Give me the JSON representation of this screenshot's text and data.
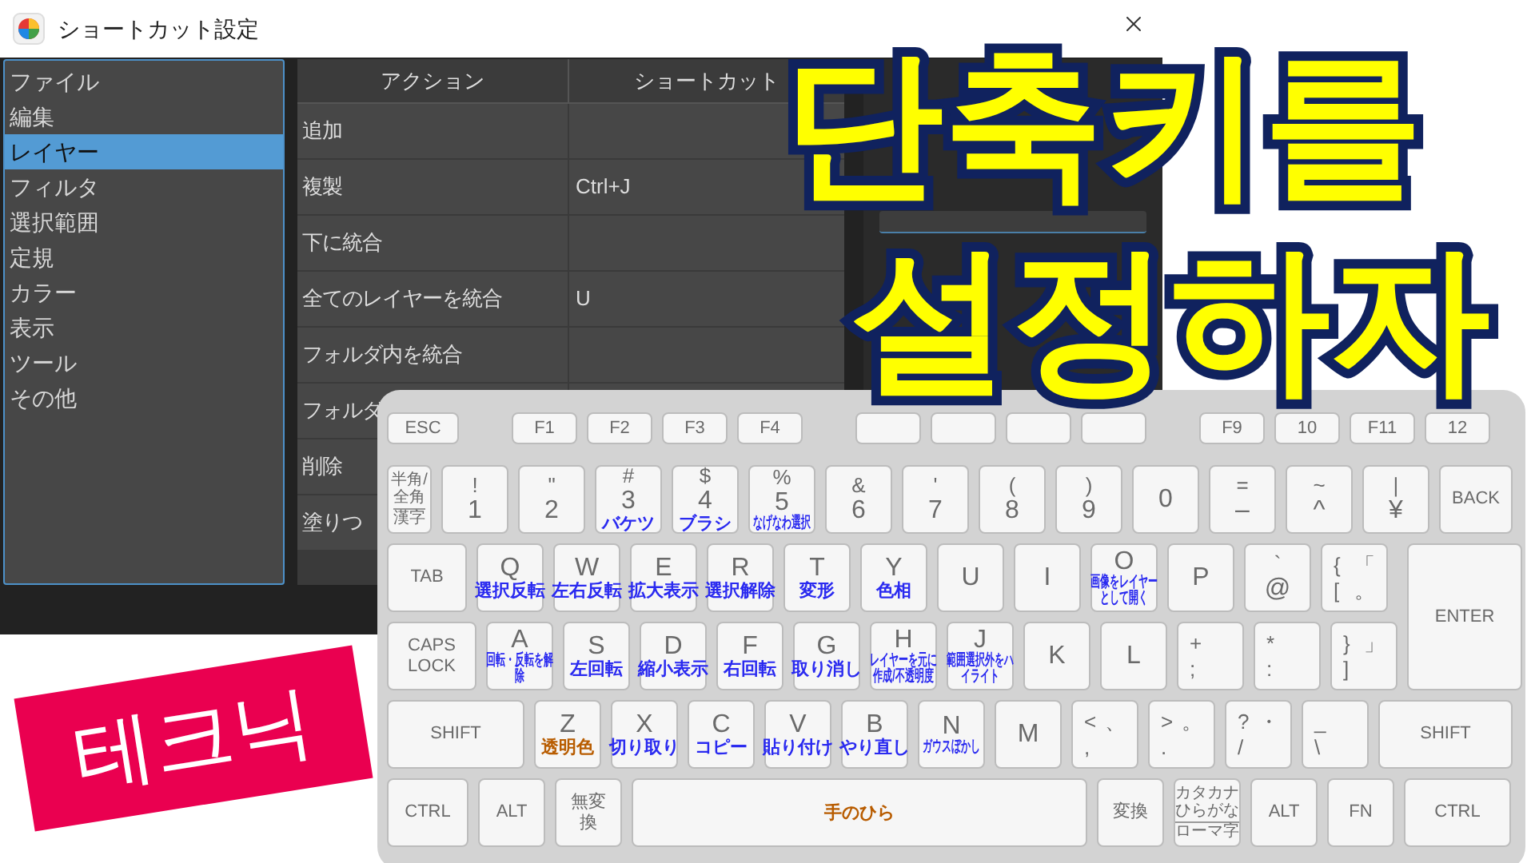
{
  "dialog": {
    "title": "ショートカット設定",
    "categories": [
      {
        "label": "ファイル",
        "selected": false
      },
      {
        "label": "編集",
        "selected": false
      },
      {
        "label": "レイヤー",
        "selected": true
      },
      {
        "label": "フィルタ",
        "selected": false
      },
      {
        "label": "選択範囲",
        "selected": false
      },
      {
        "label": "定規",
        "selected": false
      },
      {
        "label": "カラー",
        "selected": false
      },
      {
        "label": "表示",
        "selected": false
      },
      {
        "label": "ツール",
        "selected": false
      },
      {
        "label": "その他",
        "selected": false
      }
    ],
    "table": {
      "columns": [
        "アクション",
        "ショートカット"
      ],
      "rows": [
        {
          "action": "追加"
        },
        {
          "action": "複製",
          "shortcut": "Ctrl+J"
        },
        {
          "action": "下に統合"
        },
        {
          "action": "全てのレイヤーを統合",
          "shortcut": "U"
        },
        {
          "action": "フォルダ内を統合"
        },
        {
          "action": "フォルダ"
        },
        {
          "action": "削除"
        },
        {
          "action": "塗りつ"
        }
      ]
    }
  },
  "keyboard": {
    "rows": [
      {
        "keys": [
          {
            "kind": "label",
            "label": "ESC"
          },
          {
            "kind": "label",
            "label": "F1"
          },
          {
            "kind": "label",
            "label": "F2"
          },
          {
            "kind": "label",
            "label": "F3"
          },
          {
            "kind": "label",
            "label": "F4"
          },
          {
            "kind": "blank"
          },
          {
            "kind": "blank"
          },
          {
            "kind": "blank"
          },
          {
            "kind": "blank"
          },
          {
            "kind": "label",
            "label": "F9"
          },
          {
            "kind": "label",
            "label": "10"
          },
          {
            "kind": "label",
            "label": "F11"
          },
          {
            "kind": "label",
            "label": "12"
          }
        ]
      },
      {
        "keys": [
          {
            "kind": "stack",
            "lines": [
              "半角/",
              "全角",
              "漢字"
            ]
          },
          {
            "kind": "sym",
            "top": "!",
            "main": "1"
          },
          {
            "kind": "sym",
            "top": "\"",
            "main": "2"
          },
          {
            "kind": "sym",
            "top": "#",
            "main": "3",
            "action": "バケツ",
            "color": "#2a2af0"
          },
          {
            "kind": "sym",
            "top": "$",
            "main": "4",
            "action": "ブラシ",
            "color": "#2a2af0"
          },
          {
            "kind": "sym",
            "top": "%",
            "main": "5",
            "action": "なげなわ選択",
            "color": "#2a2af0"
          },
          {
            "kind": "sym",
            "top": "&",
            "main": "6"
          },
          {
            "kind": "sym",
            "top": "'",
            "main": "7"
          },
          {
            "kind": "sym",
            "top": "(",
            "main": "8"
          },
          {
            "kind": "sym",
            "top": ")",
            "main": "9"
          },
          {
            "kind": "sym",
            "main": "0"
          },
          {
            "kind": "sym",
            "top": "=",
            "main": "–"
          },
          {
            "kind": "sym",
            "top": "~",
            "main": "^"
          },
          {
            "kind": "sym",
            "top": "|",
            "main": "¥"
          },
          {
            "kind": "label",
            "label": "BACK"
          }
        ]
      },
      {
        "keys": [
          {
            "kind": "label",
            "label": "TAB"
          },
          {
            "kind": "sym",
            "main": "Q",
            "action": "選択反転",
            "color": "#2a2af0"
          },
          {
            "kind": "sym",
            "main": "W",
            "action": "左右反転",
            "color": "#2a2af0"
          },
          {
            "kind": "sym",
            "main": "E",
            "action": "拡大表示",
            "color": "#2a2af0"
          },
          {
            "kind": "sym",
            "main": "R",
            "action": "選択解除",
            "color": "#2a2af0"
          },
          {
            "kind": "sym",
            "main": "T",
            "action": "変形",
            "color": "#2a2af0"
          },
          {
            "kind": "sym",
            "main": "Y",
            "action": "色相",
            "color": "#2a2af0"
          },
          {
            "kind": "sym",
            "main": "U"
          },
          {
            "kind": "sym",
            "main": "I"
          },
          {
            "kind": "sym",
            "main": "O",
            "action": "画像をレイヤーとして開く",
            "color": "#2a2af0"
          },
          {
            "kind": "sym",
            "main": "P"
          },
          {
            "kind": "sym",
            "top": "`",
            "main": "@"
          },
          {
            "kind": "quad",
            "top": [
              "{",
              "「"
            ],
            "bottom": [
              "[",
              "。"
            ]
          },
          {
            "kind": "label",
            "label": "ENTER"
          }
        ]
      },
      {
        "keys": [
          {
            "kind": "label",
            "label": "CAPS LOCK"
          },
          {
            "kind": "sym",
            "main": "A",
            "action": "回転・反転を解除",
            "color": "#2a2af0"
          },
          {
            "kind": "sym",
            "main": "S",
            "action": "左回転",
            "color": "#2a2af0"
          },
          {
            "kind": "sym",
            "main": "D",
            "action": "縮小表示",
            "color": "#2a2af0"
          },
          {
            "kind": "sym",
            "main": "F",
            "action": "右回転",
            "color": "#2a2af0"
          },
          {
            "kind": "sym",
            "main": "G",
            "action": "取り消し",
            "color": "#2a2af0"
          },
          {
            "kind": "sym",
            "main": "H",
            "action": "レイヤーを元に作成/不透明度",
            "color": "#2a2af0"
          },
          {
            "kind": "sym",
            "main": "J",
            "action": "範囲選択外をハイライト",
            "color": "#2a2af0"
          },
          {
            "kind": "sym",
            "main": "K"
          },
          {
            "kind": "sym",
            "main": "L"
          },
          {
            "kind": "quad",
            "top": [
              "+"
            ],
            "bottom": [
              ";"
            ]
          },
          {
            "kind": "quad",
            "top": [
              "*"
            ],
            "bottom": [
              ":"
            ]
          },
          {
            "kind": "quad",
            "top": [
              "}",
              "」"
            ],
            "bottom": [
              "]"
            ]
          }
        ]
      },
      {
        "keys": [
          {
            "kind": "label",
            "label": "SHIFT"
          },
          {
            "kind": "sym",
            "main": "Z",
            "action": "透明色",
            "color": "#b85c00"
          },
          {
            "kind": "sym",
            "main": "X",
            "action": "切り取り",
            "color": "#2a2af0"
          },
          {
            "kind": "sym",
            "main": "C",
            "action": "コピー",
            "color": "#2a2af0"
          },
          {
            "kind": "sym",
            "main": "V",
            "action": "貼り付け",
            "color": "#2a2af0"
          },
          {
            "kind": "sym",
            "main": "B",
            "action": "やり直し",
            "color": "#2a2af0"
          },
          {
            "kind": "sym",
            "main": "N",
            "action": "ガウスぼかし",
            "color": "#2a2af0"
          },
          {
            "kind": "sym",
            "main": "M"
          },
          {
            "kind": "quad",
            "top": [
              "<",
              "、"
            ],
            "bottom": [
              ","
            ]
          },
          {
            "kind": "quad",
            "top": [
              ">",
              "。"
            ],
            "bottom": [
              "."
            ]
          },
          {
            "kind": "quad",
            "top": [
              "?",
              "・"
            ],
            "bottom": [
              "/"
            ]
          },
          {
            "kind": "quad",
            "top": [
              "_"
            ],
            "bottom": [
              "\\"
            ]
          },
          {
            "kind": "label",
            "label": "SHIFT"
          }
        ]
      },
      {
        "keys": [
          {
            "kind": "label",
            "label": "CTRL"
          },
          {
            "kind": "label",
            "label": "ALT"
          },
          {
            "kind": "label",
            "label": "無変換"
          },
          {
            "kind": "sym",
            "action": "手のひら",
            "color": "#b85c00"
          },
          {
            "kind": "label",
            "label": "変換"
          },
          {
            "kind": "stack",
            "lines": [
              "カタカナ",
              "ひらがな",
              "ローマ字"
            ]
          },
          {
            "kind": "label",
            "label": "ALT"
          },
          {
            "kind": "label",
            "label": "FN"
          },
          {
            "kind": "label",
            "label": "CTRL"
          }
        ]
      }
    ]
  },
  "headline": {
    "lines": [
      "단축키를",
      "설정하자"
    ]
  },
  "badge": "테크닉"
}
